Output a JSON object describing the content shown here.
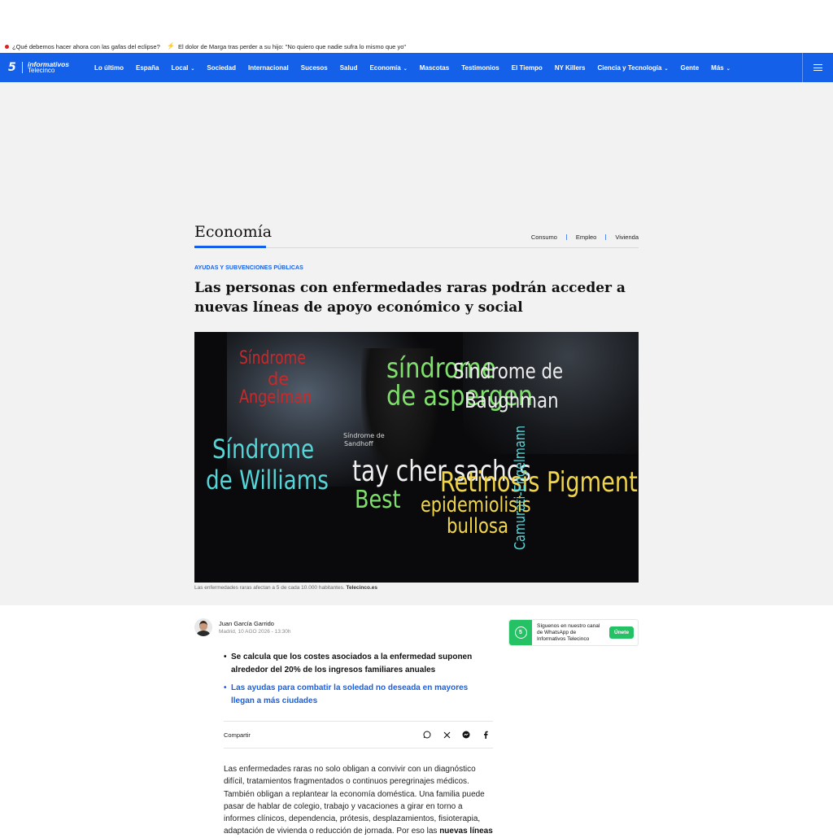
{
  "ticker": {
    "item1": "¿Qué debemos hacer ahora con las gafas del eclipse?",
    "item2": "El dolor de Marga tras perder a su hijo: \"No quiero que nadie sufra lo mismo que yo\""
  },
  "brand": {
    "five": "5",
    "line1": "informativos",
    "line2": "Telecinco"
  },
  "nav": {
    "items": [
      {
        "label": "Lo último"
      },
      {
        "label": "España"
      },
      {
        "label": "Local"
      },
      {
        "label": "Sociedad"
      },
      {
        "label": "Internacional"
      },
      {
        "label": "Sucesos"
      },
      {
        "label": "Salud"
      },
      {
        "label": "Economía"
      },
      {
        "label": "Mascotas"
      },
      {
        "label": "Testimonios"
      },
      {
        "label": "El Tiempo"
      },
      {
        "label": "NY Killers"
      },
      {
        "label": "Ciencia y Tecnología"
      },
      {
        "label": "Gente"
      },
      {
        "label": "Más"
      }
    ]
  },
  "section": {
    "title": "Economía",
    "subnav": [
      "Consumo",
      "Empleo",
      "Vivienda"
    ]
  },
  "article": {
    "kicker": "AYUDAS Y SUBVENCIONES PÚBLICAS",
    "headline": "Las personas con enfermedades raras podrán acceder a nuevas líneas de apoyo económico y social",
    "image_words": {
      "w1": "Síndrome",
      "w2": "de",
      "w3": "Angelman",
      "w4": "síndrome",
      "w5": "de aspergen",
      "w6": "Síndrome de",
      "w7": "Baughman",
      "w8": "Síndrome de",
      "w9": "Sandhoff",
      "w10": "Síndrome",
      "w11": "de Williams",
      "w12": "tay cher sachcs",
      "w13": "Retinosis Pigmenta",
      "w14": "Best",
      "w15": "epidemiolisis",
      "w16": "bullosa",
      "w17": "Camurati-Engelmann"
    },
    "caption_text": "Las enfermedades raras afectan a 5 de cada 10.000 habitantes.",
    "caption_credit": "Telecinco.es",
    "author_name": "Juan García Garrido",
    "date": "Madrid, 10 AGO 2026 - 13:30h",
    "bullet1": "Se calcula que los costes asociados a la enfermedad suponen alrededor del 20% de los ingresos familiares anuales",
    "bullet2": "Las ayudas para combatir la soledad no deseada en mayores llegan a más ciudades",
    "share_label": "Compartir",
    "share_icons": [
      "whatsapp-icon",
      "x-icon",
      "messenger-icon",
      "facebook-icon"
    ],
    "body_main": "Las enfermedades raras no solo obligan a convivir con un diagnóstico difícil, tratamientos fragmentados o continuos peregrinajes médicos. También obligan a replantear la economía doméstica. Una familia puede pasar de hablar de colegio, trabajo y vacaciones a girar en torno a informes clínicos, dependencia, prótesis, desplazamientos, fisioterapia, adaptación de vivienda o reducción de jornada. Por eso las",
    "body_bold": "nuevas líneas"
  },
  "whatsapp": {
    "text": "Síguenos en nuestro canal de WhatsApp de Informativos Telecinco",
    "button": "Únete"
  },
  "colors": {
    "brand_blue": "#1560e8",
    "whatsapp_green": "#25c265"
  }
}
